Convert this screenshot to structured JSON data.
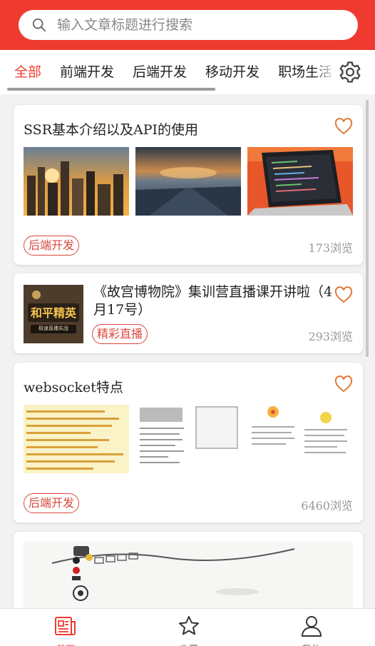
{
  "search": {
    "placeholder": "输入文章标题进行搜索"
  },
  "tabs": [
    {
      "label": "全部",
      "active": true
    },
    {
      "label": "前端开发",
      "active": false
    },
    {
      "label": "后端开发",
      "active": false
    },
    {
      "label": "移动开发",
      "active": false
    },
    {
      "label": "职场生活",
      "active": false
    }
  ],
  "articles": [
    {
      "title": "SSR基本介绍以及API的使用",
      "tag": "后端开发",
      "views": "173浏览",
      "liked": false
    },
    {
      "title": "《故宫博物院》集训营直播课开讲啦（4月17号）",
      "tag": "精彩直播",
      "views": "293浏览",
      "liked": false,
      "cover_text": "和平精英",
      "cover_subtext": "极速直播实战"
    },
    {
      "title": "websocket特点",
      "tag": "后端开发",
      "views": "6460浏览",
      "liked": false
    }
  ],
  "bottom_nav": [
    {
      "label": "首页",
      "icon": "news-icon",
      "active": true
    },
    {
      "label": "收藏",
      "icon": "star-icon",
      "active": false
    },
    {
      "label": "我的",
      "icon": "user-icon",
      "active": false
    }
  ],
  "colors": {
    "brand": "#ef3b2f",
    "tag": "#d9473c"
  }
}
